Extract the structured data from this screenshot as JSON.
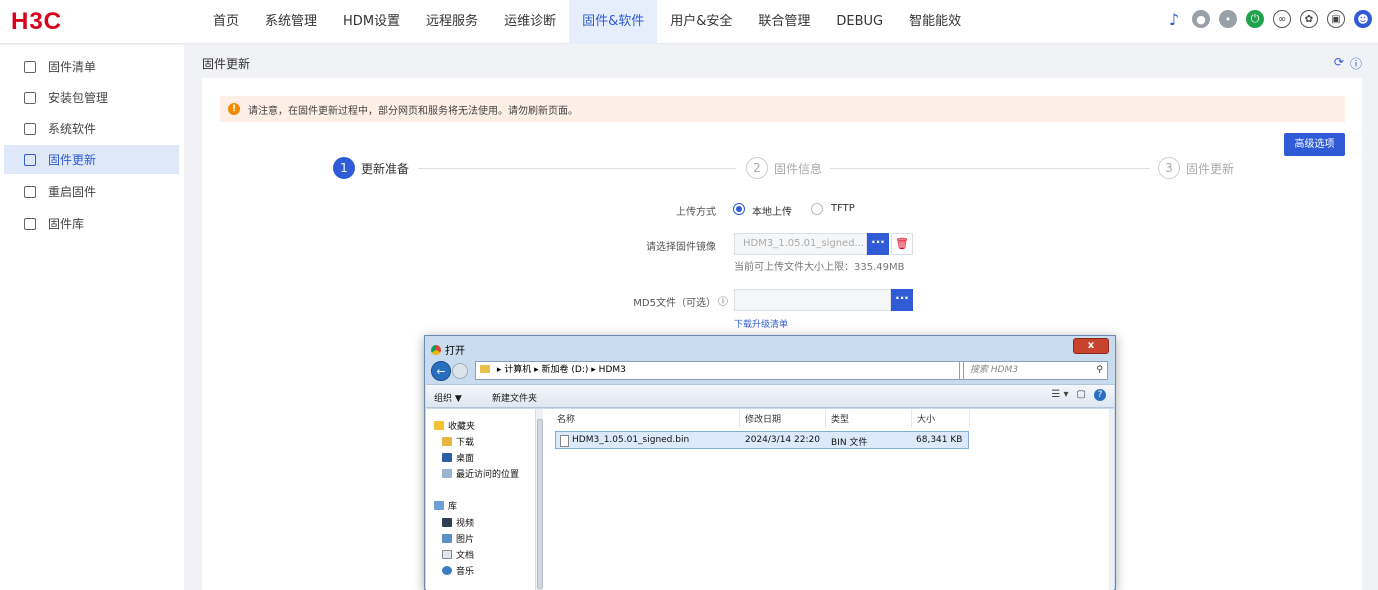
{
  "brand": {
    "logo": "H3C"
  },
  "nav": {
    "items": [
      {
        "label": "首页"
      },
      {
        "label": "系统管理"
      },
      {
        "label": "HDM设置"
      },
      {
        "label": "远程服务"
      },
      {
        "label": "运维诊断"
      },
      {
        "label": "固件&软件"
      },
      {
        "label": "用户&安全"
      },
      {
        "label": "联合管理"
      },
      {
        "label": "DEBUG"
      },
      {
        "label": "智能能效"
      }
    ],
    "active_index": 5
  },
  "top_icons": [
    "bell-icon",
    "status-gray-icon",
    "uid-icon",
    "power-icon",
    "link-icon",
    "palette-icon",
    "clipboard-icon",
    "user-avatar-icon"
  ],
  "sidebar": {
    "items": [
      {
        "label": "固件清单",
        "icon": "list-icon"
      },
      {
        "label": "安装包管理",
        "icon": "package-icon"
      },
      {
        "label": "系统软件",
        "icon": "monitor-icon"
      },
      {
        "label": "固件更新",
        "icon": "update-icon"
      },
      {
        "label": "重启固件",
        "icon": "restart-icon"
      },
      {
        "label": "固件库",
        "icon": "cube-icon"
      }
    ],
    "active_index": 3
  },
  "page": {
    "title": "固件更新",
    "notice": "请注意，在固件更新过程中，部分网页和服务将无法使用。请勿刷新页面。",
    "advanced_button": "高级选项"
  },
  "steps": [
    {
      "num": "1",
      "label": "更新准备",
      "active": true
    },
    {
      "num": "2",
      "label": "固件信息",
      "active": false
    },
    {
      "num": "3",
      "label": "固件更新",
      "active": false
    }
  ],
  "form": {
    "upload_method_label": "上传方式",
    "upload_options": [
      {
        "label": "本地上传",
        "selected": true
      },
      {
        "label": "TFTP",
        "selected": false
      }
    ],
    "image_label": "请选择固件镜像",
    "image_value": "HDM3_1.05.01_signed...",
    "size_hint": "当前可上传文件大小上限：335.49MB",
    "md5_label": "MD5文件（可选）",
    "download_link": "下载升级清单",
    "browse_label": "···"
  },
  "dialog": {
    "title": "打开",
    "close": "x",
    "address": [
      "计算机",
      "新加卷 (D:)",
      "HDM3"
    ],
    "search_placeholder": "搜索 HDM3",
    "toolbar": {
      "organize": "组织 ▼",
      "new_folder": "新建文件夹"
    },
    "nav_pane": {
      "favorites": "收藏夹",
      "favorites_items": [
        "下载",
        "桌面",
        "最近访问的位置"
      ],
      "library": "库",
      "library_items": [
        "视频",
        "图片",
        "文档",
        "音乐"
      ]
    },
    "columns": [
      "名称",
      "修改日期",
      "类型",
      "大小"
    ],
    "files": [
      {
        "name": "HDM3_1.05.01_signed.bin",
        "date": "2024/3/14 22:20",
        "type": "BIN 文件",
        "size": "68,341 KB"
      }
    ]
  }
}
